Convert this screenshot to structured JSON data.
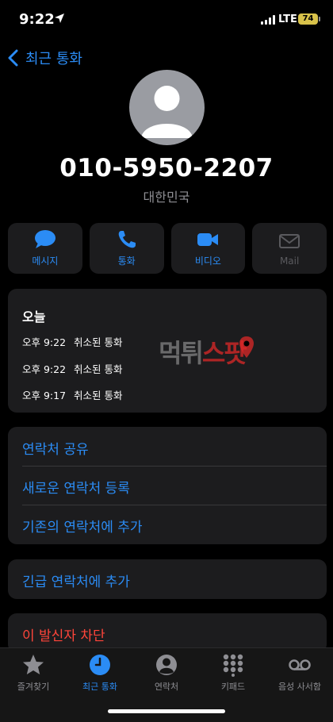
{
  "status_bar": {
    "time": "9:22",
    "network": "LTE",
    "battery": "74"
  },
  "nav": {
    "back_label": "최근 통화"
  },
  "contact": {
    "phone_number": "010-5950-2207",
    "country": "대한민국"
  },
  "actions": [
    {
      "label": "메시지",
      "icon": "message-icon",
      "enabled": true
    },
    {
      "label": "통화",
      "icon": "phone-icon",
      "enabled": true
    },
    {
      "label": "비디오",
      "icon": "video-icon",
      "enabled": true
    },
    {
      "label": "Mail",
      "icon": "mail-icon",
      "enabled": false
    }
  ],
  "history": {
    "title": "오늘",
    "entries": [
      {
        "time": "오후 9:22",
        "status": "취소된 통화"
      },
      {
        "time": "오후 9:22",
        "status": "취소된 통화"
      },
      {
        "time": "오후 9:17",
        "status": "취소된 통화"
      }
    ]
  },
  "watermark": {
    "text_gray": "먹튀",
    "text_red": "스팟"
  },
  "options": [
    "연락처 공유",
    "새로운 연락처 등록",
    "기존의 연락처에 추가"
  ],
  "emergency": "긴급 연락처에 추가",
  "block": "이 발신자 차단",
  "tabs": [
    {
      "label": "즐겨찾기",
      "icon": "star-icon",
      "active": false
    },
    {
      "label": "최근 통화",
      "icon": "clock-icon",
      "active": true
    },
    {
      "label": "연락처",
      "icon": "person-circle-icon",
      "active": false
    },
    {
      "label": "키패드",
      "icon": "keypad-icon",
      "active": false
    },
    {
      "label": "음성 사서함",
      "icon": "voicemail-icon",
      "active": false
    }
  ],
  "colors": {
    "accent": "#2b8cf5",
    "destructive": "#ff453a",
    "card": "#1c1c1e",
    "battery": "#d8c24a"
  }
}
